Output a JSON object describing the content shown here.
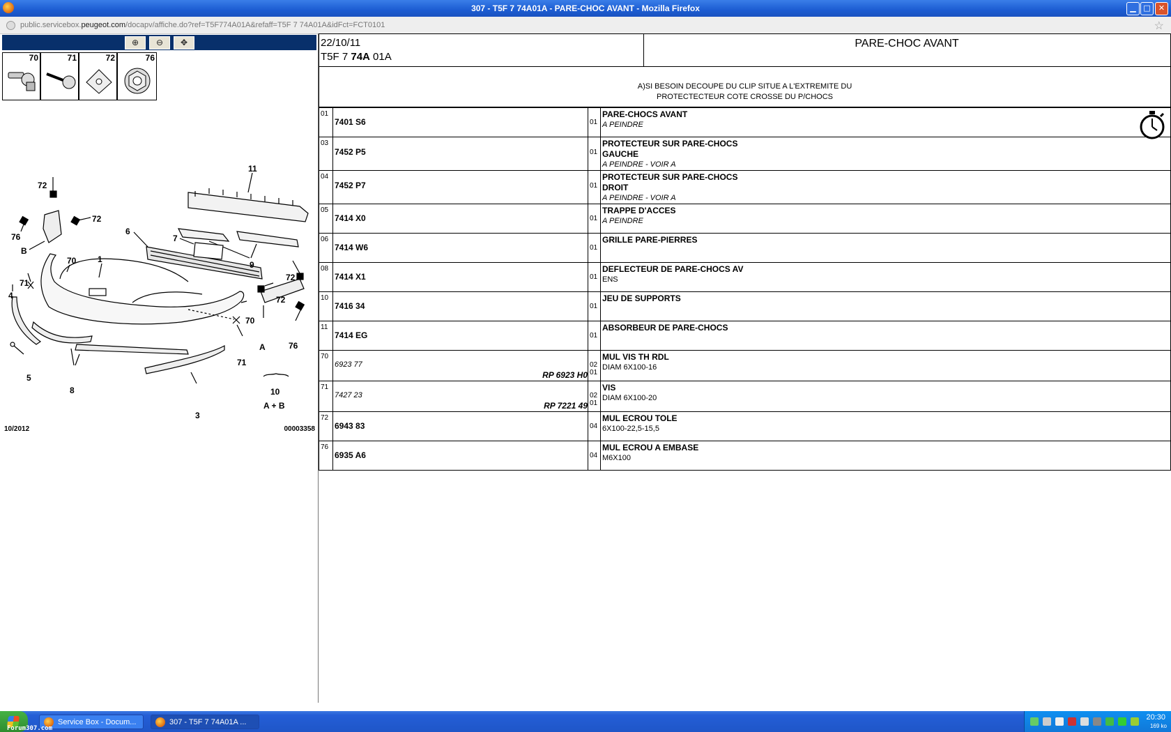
{
  "window": {
    "title": "307 - T5F 7 74A01A - PARE-CHOC AVANT - Mozilla Firefox",
    "min": "▁",
    "max": "□",
    "close": "✕"
  },
  "address": {
    "url_prefix": "public.servicebox.",
    "url_domain": "peugeot.com",
    "url_suffix": "/docapv/affiche.do?ref=T5F774A01A&refaff=T5F 7 74A01A&idFct=FCT0101"
  },
  "toolbar": {
    "zoom_in": "⊕",
    "zoom_out": "⊖",
    "pan": "✥"
  },
  "thumbs": [
    "70",
    "71",
    "72",
    "76"
  ],
  "diagram": {
    "labels": [
      "11",
      "72",
      "72",
      "76",
      "B",
      "6",
      "7",
      "9",
      "72",
      "70",
      "1",
      "71",
      "4",
      "72",
      "70",
      "5",
      "8",
      "3",
      "A",
      "71",
      "76",
      "10"
    ],
    "group_label": "A + B",
    "footer_left": "10/2012",
    "footer_right": "00003358"
  },
  "header": {
    "date": "22/10/11",
    "ref_a": "T5F 7 ",
    "ref_b": "74A",
    "ref_c": " 01A",
    "title": "PARE-CHOC AVANT"
  },
  "note": {
    "line1": "A)SI BESOIN DECOUPE DU CLIP SITUE A L'EXTREMITE DU",
    "line2": "PROTECTECTEUR COTE CROSSE DU P/CHOCS"
  },
  "parts": [
    {
      "item": "01",
      "pn": "7401 S6",
      "qty": "01",
      "desc": "PARE-CHOCS AVANT",
      "sub": "A PEINDRE",
      "sub_italic": true
    },
    {
      "item": "03",
      "pn": "7452 P5",
      "qty": "01",
      "desc": "PROTECTEUR SUR PARE-CHOCS",
      "desc2": "GAUCHE",
      "sub": "A PEINDRE - VOIR A",
      "sub_italic": true
    },
    {
      "item": "04",
      "pn": "7452 P7",
      "qty": "01",
      "desc": "PROTECTEUR SUR PARE-CHOCS",
      "desc2": "DROIT",
      "sub": "A PEINDRE - VOIR A",
      "sub_italic": true
    },
    {
      "item": "05",
      "pn": "7414 X0",
      "qty": "01",
      "desc": "TRAPPE D'ACCES",
      "sub": "A PEINDRE",
      "sub_italic": true
    },
    {
      "item": "06",
      "pn": "7414 W6",
      "qty": "01",
      "desc": "GRILLE PARE-PIERRES"
    },
    {
      "item": "08",
      "pn": "7414 X1",
      "qty": "01",
      "desc": "DEFLECTEUR DE PARE-CHOCS AV",
      "sub": "ENS"
    },
    {
      "item": "10",
      "pn": "7416 34",
      "qty": "01",
      "desc": "JEU DE SUPPORTS"
    },
    {
      "item": "11",
      "pn": "7414 EG",
      "qty": "01",
      "desc": "ABSORBEUR DE PARE-CHOCS"
    },
    {
      "item": "70",
      "pn": "6923 77",
      "pn_italic": true,
      "rp": "RP 6923 H0",
      "qty": "02",
      "qty2": "01",
      "desc": "MUL VIS TH RDL",
      "sub": "DIAM 6X100-16"
    },
    {
      "item": "71",
      "pn": "7427 23",
      "pn_italic": true,
      "rp": "RP 7221 49",
      "qty": "02",
      "qty2": "01",
      "desc": "VIS",
      "sub": "DIAM 6X100-20"
    },
    {
      "item": "72",
      "pn": "6943 83",
      "qty": "04",
      "desc": "MUL ECROU TOLE",
      "sub": "6X100-22,5-15,5"
    },
    {
      "item": "76",
      "pn": "6935 A6",
      "qty": "04",
      "desc": "MUL ECROU A EMBASE",
      "sub": "M6X100"
    }
  ],
  "taskbar": {
    "task1": "Service Box - Docum...",
    "task2": "307 - T5F 7 74A01A ...",
    "clock": "20:30",
    "net": "169 ko",
    "watermark": "Forum307.com"
  }
}
